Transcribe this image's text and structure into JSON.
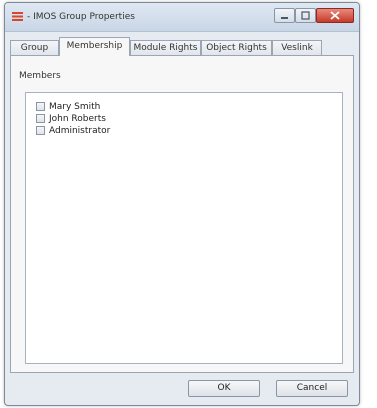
{
  "window": {
    "title": "- IMOS Group Properties"
  },
  "tabs": [
    {
      "label": "Group"
    },
    {
      "label": "Membership"
    },
    {
      "label": "Module Rights"
    },
    {
      "label": "Object Rights"
    },
    {
      "label": "Veslink"
    }
  ],
  "membership": {
    "label": "Members",
    "members": [
      {
        "name": "Mary Smith",
        "checked": false
      },
      {
        "name": "John Roberts",
        "checked": false
      },
      {
        "name": "Administrator",
        "checked": false
      }
    ]
  },
  "buttons": {
    "ok": "OK",
    "cancel": "Cancel"
  },
  "colors": {
    "app_icon": "#d9472b",
    "close_button": "#c63b2a"
  }
}
